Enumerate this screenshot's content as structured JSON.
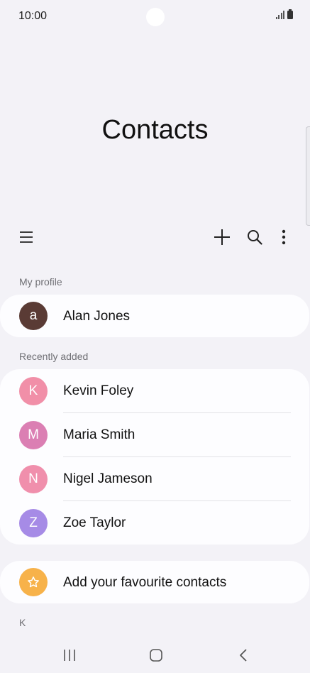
{
  "status_bar": {
    "time": "10:00"
  },
  "header": {
    "title": "Contacts"
  },
  "toolbar": {
    "menu_icon": "menu-icon",
    "add_icon": "plus-icon",
    "search_icon": "search-icon",
    "more_icon": "more-vertical-icon"
  },
  "my_profile": {
    "label": "My profile",
    "name": "Alan Jones",
    "initial": "a",
    "color": "#5a3b35"
  },
  "recently_added": {
    "label": "Recently added",
    "contacts": [
      {
        "name": "Kevin Foley",
        "initial": "K",
        "color": "#f18fa8"
      },
      {
        "name": "Maria Smith",
        "initial": "M",
        "color": "#db7fb3"
      },
      {
        "name": "Nigel Jameson",
        "initial": "N",
        "color": "#f08fac"
      },
      {
        "name": "Zoe Taylor",
        "initial": "Z",
        "color": "#a68be6"
      }
    ]
  },
  "favourites": {
    "label": "Add your favourite contacts",
    "icon": "star-icon",
    "color": "#f7b24a"
  },
  "index_letter": "K",
  "nav": {
    "recents": "recents-icon",
    "home": "home-icon",
    "back": "back-icon"
  }
}
